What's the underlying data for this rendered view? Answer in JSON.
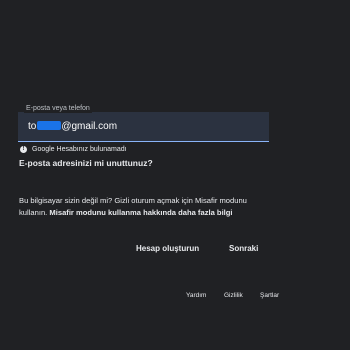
{
  "email": {
    "label": "E-posta veya telefon",
    "value_prefix": "to",
    "value_suffix": "gmail.com",
    "value_at": "@"
  },
  "error": {
    "icon": "info-icon",
    "text": "Google Hesabınız bulunamadı"
  },
  "forgot_email_label": "E-posta adresinizi mi unuttunuz?",
  "guest_mode": {
    "line1": "Bu bilgisayar sizin değil mi? Gizli oturum açmak için Misafir modunu",
    "line2_prefix": "kullanın. ",
    "learn_more": "Misafir modunu kullanma hakkında daha fazla bilgi"
  },
  "actions": {
    "create_account": "Hesap oluşturun",
    "next": "Sonraki"
  },
  "footer": {
    "help": "Yardım",
    "privacy": "Gizlilik",
    "terms": "Şartlar"
  },
  "colors": {
    "background": "#202124",
    "accent": "#8ab4f8",
    "field_fill": "#2b3240",
    "text": "#e8eaed"
  }
}
